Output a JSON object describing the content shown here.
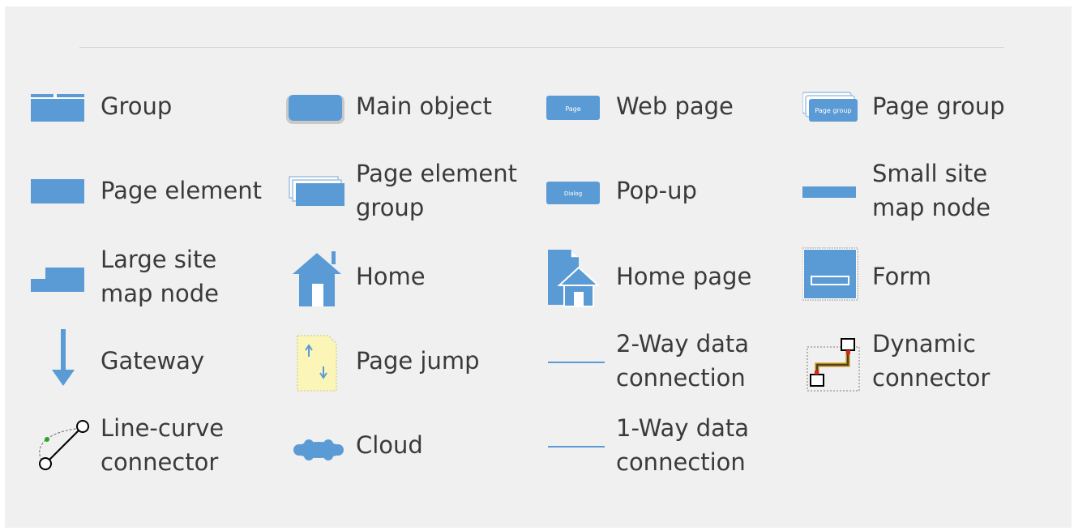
{
  "accent_color": "#5b9bd5",
  "shapes": [
    {
      "label": "Group",
      "icon": "group-icon"
    },
    {
      "label": "Main object",
      "icon": "main-object-icon"
    },
    {
      "label": "Web page",
      "icon": "web-page-icon",
      "icon_text": "Page"
    },
    {
      "label": "Page group",
      "icon": "page-group-icon",
      "icon_text": "Page group"
    },
    {
      "label": "Page element",
      "icon": "page-element-icon"
    },
    {
      "label": "Page element\ngroup",
      "icon": "page-element-group-icon"
    },
    {
      "label": "Pop-up",
      "icon": "pop-up-icon",
      "icon_text": "Dialog"
    },
    {
      "label": "Small site\nmap node",
      "icon": "small-site-map-node-icon"
    },
    {
      "label": "Large site\nmap node",
      "icon": "large-site-map-node-icon"
    },
    {
      "label": "Home",
      "icon": "home-icon"
    },
    {
      "label": "Home page",
      "icon": "home-page-icon"
    },
    {
      "label": "Form",
      "icon": "form-icon"
    },
    {
      "label": "Gateway",
      "icon": "gateway-arrow-icon"
    },
    {
      "label": "Page jump",
      "icon": "page-jump-icon"
    },
    {
      "label": "2-Way data\nconnection",
      "icon": "two-way-line-icon"
    },
    {
      "label": "Dynamic\nconnector",
      "icon": "dynamic-connector-icon"
    },
    {
      "label": "Line-curve\nconnector",
      "icon": "line-curve-connector-icon"
    },
    {
      "label": "Cloud",
      "icon": "cloud-icon"
    },
    {
      "label": "1-Way data\nconnection",
      "icon": "one-way-line-icon"
    }
  ]
}
